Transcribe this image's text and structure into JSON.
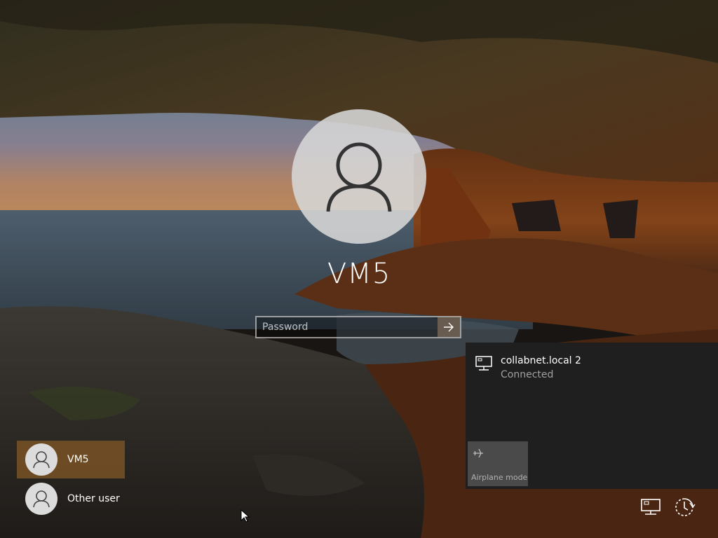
{
  "lock_screen": {
    "username": "VM5",
    "password_placeholder": "Password"
  },
  "user_list": [
    {
      "label": "VM5",
      "selected": true
    },
    {
      "label": "Other user",
      "selected": false
    }
  ],
  "network_flyout": {
    "network_name": "collabnet.local 2",
    "network_status": "Connected",
    "airplane_mode_label": "Airplane mode"
  },
  "tray": {
    "network_icon": "network-icon",
    "power_icon": "ease-of-access-icon"
  }
}
